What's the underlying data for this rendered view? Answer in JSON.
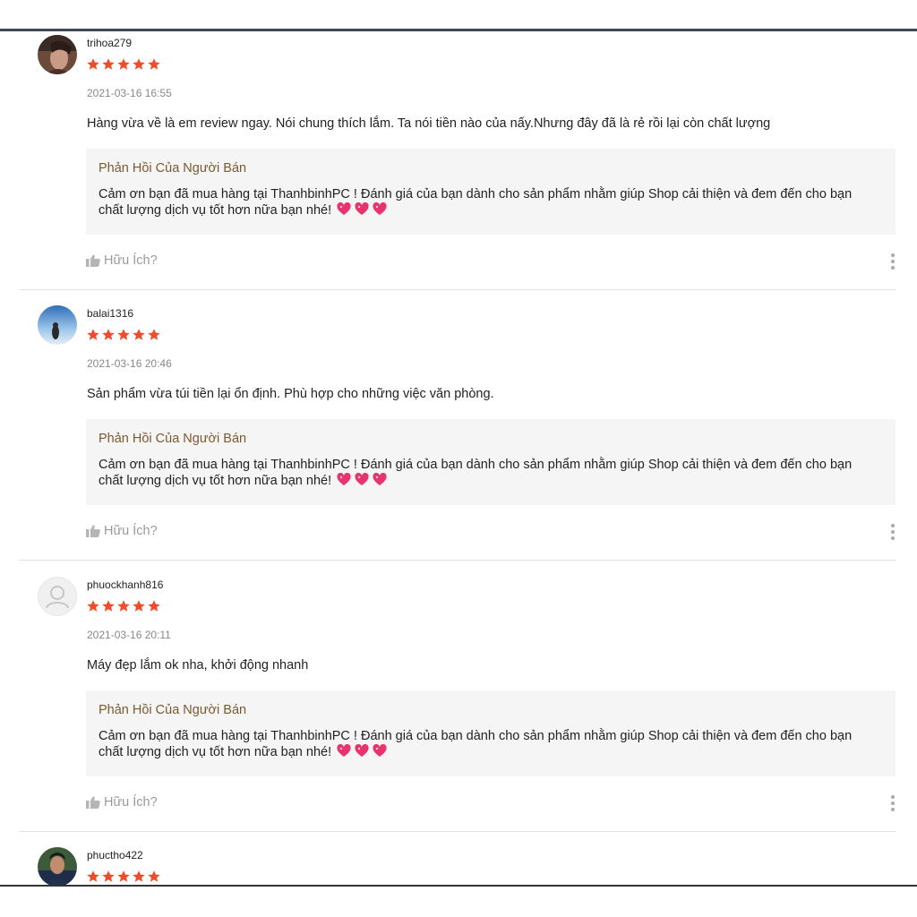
{
  "colors": {
    "star": "#ee4d2d",
    "seller_title": "#7a5a2f",
    "seller_bg": "#f5f5f5",
    "heart": "#e8336d"
  },
  "icons": {
    "star": "star-icon",
    "heart": "sparkling-heart-icon",
    "thumb": "thumbs-up-icon",
    "more": "more-vertical-icon"
  },
  "reviews": [
    {
      "username": "trihoa279",
      "rating": 5,
      "timestamp": "2021-03-16 16:55",
      "comment": "Hàng vừa về là em review ngay. Nói chung thích lắm. Ta nói tiền nào của nấy.Nhưng đây đã là rẻ rồi lại còn chất lượng",
      "seller_reply_title": "Phản Hồi Của Người Bán",
      "seller_reply": "Cảm ơn bạn đã mua hàng tại ThanhbinhPC ! Đánh giá của bạn dành cho sản phẩm nhằm giúp Shop cải thiện và đem đến cho bạn chất lượng dịch vụ tốt hơn nữa bạn nhé!",
      "helpful_label": "Hữu Ích?"
    },
    {
      "username": "balai1316",
      "rating": 5,
      "timestamp": "2021-03-16 20:46",
      "comment": "Sản phẩm vừa túi tiền lại ổn định. Phù hợp cho những việc văn phòng.",
      "seller_reply_title": "Phản Hồi Của Người Bán",
      "seller_reply": "Cảm ơn bạn đã mua hàng tại ThanhbinhPC ! Đánh giá của bạn dành cho sản phẩm nhằm giúp Shop cải thiện và đem đến cho bạn chất lượng dịch vụ tốt hơn nữa bạn nhé!",
      "helpful_label": "Hữu Ích?"
    },
    {
      "username": "phuockhanh816",
      "rating": 5,
      "timestamp": "2021-03-16 20:11",
      "comment": "Máy đẹp lắm ok nha, khởi động nhanh",
      "seller_reply_title": "Phản Hồi Của Người Bán",
      "seller_reply": "Cảm ơn bạn đã mua hàng tại ThanhbinhPC ! Đánh giá của bạn dành cho sản phẩm nhằm giúp Shop cải thiện và đem đến cho bạn chất lượng dịch vụ tốt hơn nữa bạn nhé!",
      "helpful_label": "Hữu Ích?"
    },
    {
      "username": "phuctho422",
      "rating": 5
    }
  ]
}
